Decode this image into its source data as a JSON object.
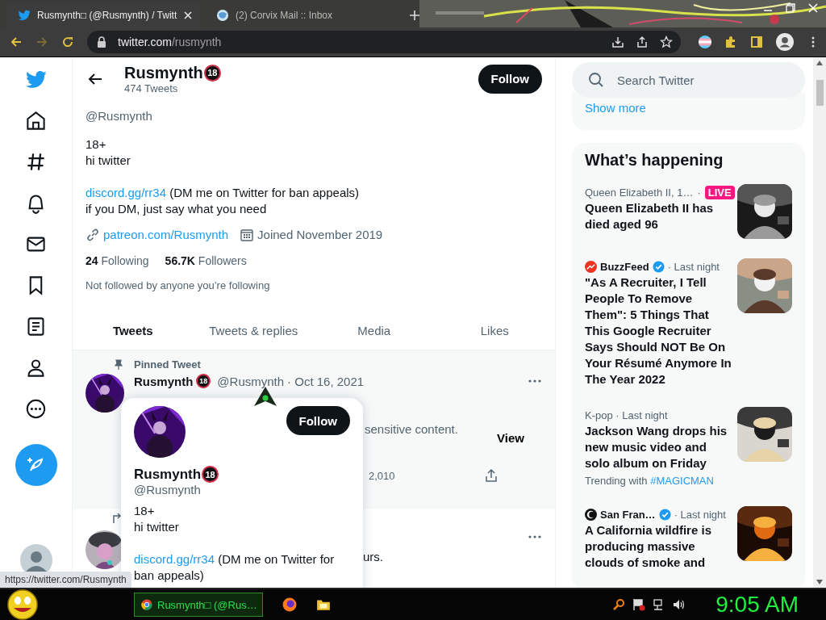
{
  "browser": {
    "tabs": [
      {
        "title": "Rusmynth□ (@Rusmynth) / Twitt",
        "selected": true,
        "kind": "twitter"
      },
      {
        "title": "(2) Corvix Mail :: Inbox",
        "selected": false,
        "kind": "mail"
      }
    ],
    "forward": {
      "disabled": true
    },
    "url": {
      "host": "twitter.com",
      "path": "/rusmynth"
    }
  },
  "profile_header": {
    "name": "Rusmynth",
    "badge": "18",
    "tweet_count": "474 Tweets",
    "follow": "Follow"
  },
  "profile": {
    "handle": "@Rusmynth",
    "bio": [
      "18+",
      "hi twitter"
    ],
    "link_text": "discord.gg/rr34",
    "link_rest": " (DM me on Twitter for ban appeals)",
    "bio_last": "if you DM, just say what you need",
    "website": "patreon.com/Rusmynth",
    "joined": "Joined November 2019",
    "stats": [
      {
        "count": "24",
        "label": "Following"
      },
      {
        "count": "56.7K",
        "label": "Followers"
      }
    ],
    "note": "Not followed by anyone you’re following"
  },
  "tabs": [
    {
      "label": "Tweets",
      "selected": true
    },
    {
      "label": "Tweets & replies",
      "selected": false
    },
    {
      "label": "Media",
      "selected": false
    },
    {
      "label": "Likes",
      "selected": false
    }
  ],
  "pinned_tweet": {
    "label": "Pinned Tweet",
    "name": "Rusmynth",
    "badge": "18",
    "handle": "@Rusmynth",
    "date": "· Oct 16, 2021",
    "sensitive": "sensitive content.",
    "view": "View",
    "count": "2,010"
  },
  "second_tweet": {
    "text": "urs."
  },
  "hover_card": {
    "follow": "Follow",
    "name": "Rusmynth",
    "badge": "18",
    "handle": "@Rusmynth",
    "bio": [
      "18+",
      "hi twitter"
    ],
    "link_text": "discord.gg/rr34",
    "link_rest": " (DM me on Twitter for ban appeals)"
  },
  "search": {
    "placeholder": "Search Twitter"
  },
  "show_more": "Show more",
  "whats_happening": {
    "title": "What’s happening",
    "trends": [
      {
        "kind": "live",
        "category": "Queen Elizabeth II, 1…",
        "separator": "·",
        "live": "LIVE",
        "title": "Queen Elizabeth II has died aged 96"
      },
      {
        "kind": "source",
        "source": "BuzzFeed",
        "verified": true,
        "time": "· Last night",
        "title": "\"As A Recruiter, I Tell People To Remove Them\": 5 Things That This Google Recruiter Says Should NOT Be On Your Résumé Anymore In The Year 2022"
      },
      {
        "kind": "topic",
        "category": "K-pop · Last night",
        "title": "Jackson Wang drops his new music video and solo album on Friday",
        "trending_label": "Trending with",
        "hashtag": "#MAGICMAN"
      },
      {
        "kind": "source",
        "source": "San Fran…",
        "verified": true,
        "time": "· Last night",
        "title": "A California wildfire is producing massive clouds of smoke and"
      }
    ]
  },
  "status_url": "https://twitter.com/Rusmynth",
  "taskbar": {
    "task": "Rusmynth□ (@Rus…",
    "clock": "9:05 AM"
  }
}
